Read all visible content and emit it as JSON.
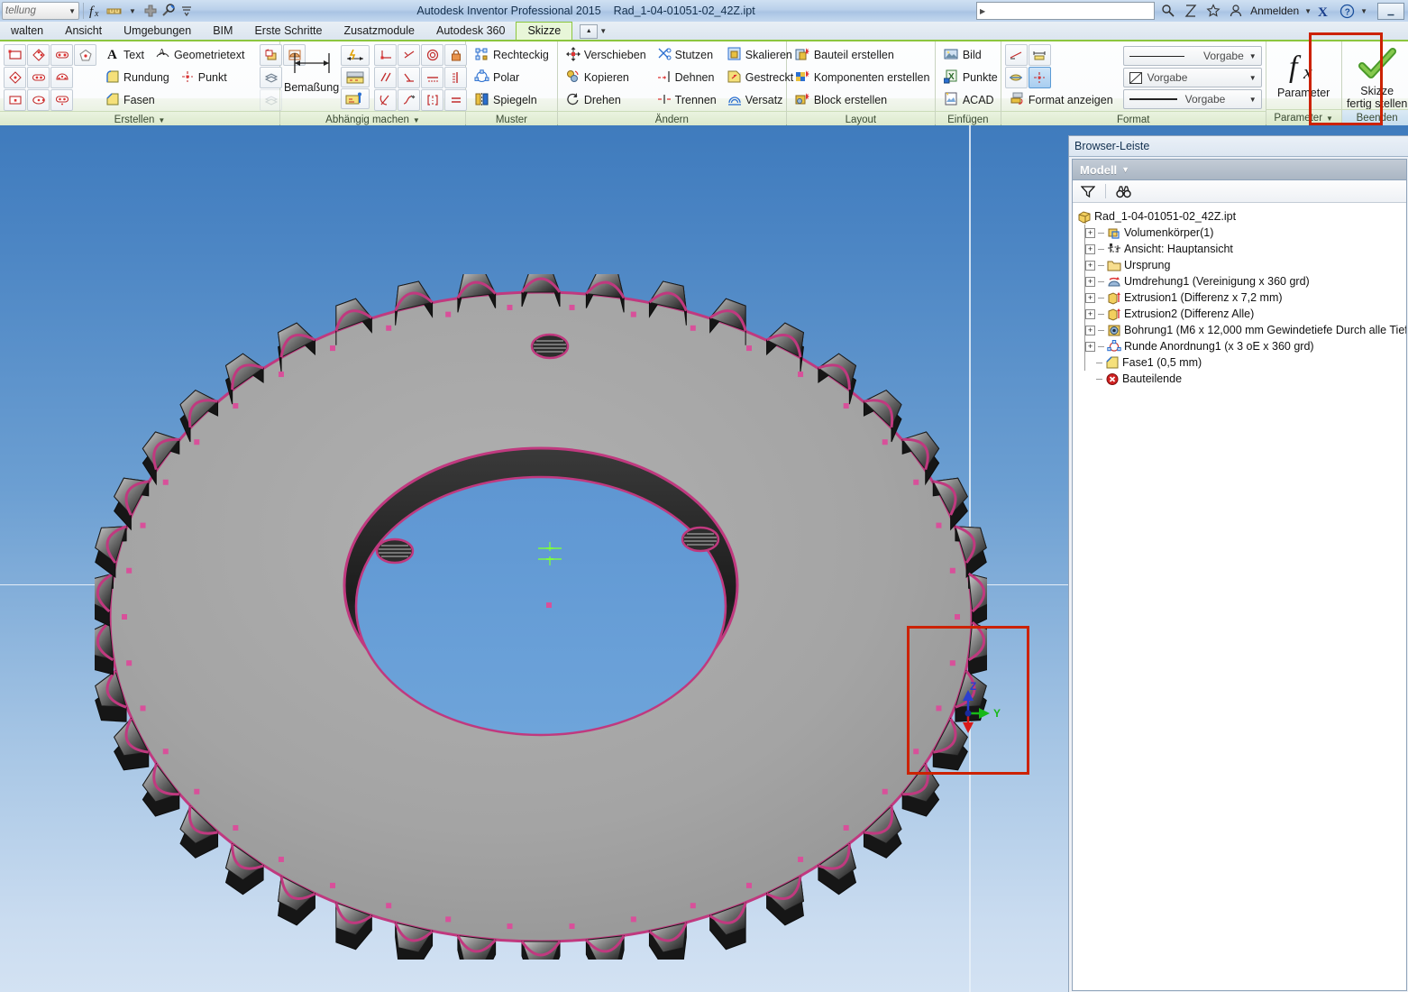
{
  "titlebar": {
    "qat_combo_value": "tellung",
    "qat_icons": [
      "fx-icon",
      "dimension-icon",
      "plus-icon",
      "tools-icon",
      "chevron-down-icon"
    ],
    "app_title": "Autodesk Inventor Professional 2015",
    "document_title": "Rad_1-04-01051-02_42Z.ipt",
    "search_placeholder": "",
    "search_value": "",
    "help_icons": [
      "search-icon",
      "exchange-icon",
      "favorites-star-icon",
      "user-icon"
    ],
    "signin_label": "Anmelden",
    "autodesk_icon": "autodesk-x-icon",
    "help_icon": "help-question-icon",
    "window_buttons": [
      "minimize-button",
      "maximize-button",
      "close-button"
    ]
  },
  "tabs": [
    {
      "label": "walten",
      "active": false
    },
    {
      "label": "Ansicht",
      "active": false
    },
    {
      "label": "Umgebungen",
      "active": false
    },
    {
      "label": "BIM",
      "active": false
    },
    {
      "label": "Erste Schritte",
      "active": false
    },
    {
      "label": "Zusatzmodule",
      "active": false
    },
    {
      "label": "Autodesk 360",
      "active": false
    },
    {
      "label": "Skizze",
      "active": true
    }
  ],
  "ribbon": {
    "groups": [
      {
        "name": "Erstellen",
        "label": "Erstellen",
        "has_dropdown": true,
        "icon_rows": [
          [
            "rectangle-icon",
            "polygon-tool-icon",
            "slot-icon",
            "pentagon-icon"
          ],
          [
            "rhombus-icon",
            "slot-center-icon",
            "slot-three-point-icon"
          ],
          [
            "rectangle-point-icon",
            "ellipse-icon",
            "slot-arc-icon"
          ]
        ],
        "text_buttons": [
          {
            "label": "Text",
            "icon": "text-a-icon"
          },
          {
            "label": "Geometrietext",
            "icon": "geometry-text-icon"
          },
          {
            "label": "Rundung",
            "icon": "fillet-icon"
          },
          {
            "label": "Punkt",
            "icon": "point-icon"
          },
          {
            "label": "Fasen",
            "icon": "chamfer-icon"
          }
        ],
        "side_icons": [
          "project-geometry-icon",
          "project-cut-edges-icon",
          "project-flat-pattern-icon",
          "project-dwg-icon"
        ]
      },
      {
        "name": "Abhaengig-machen",
        "label": "Abhängig machen",
        "has_dropdown": true,
        "big_button": {
          "label": "Bemaßung",
          "icon": "dimension-icon"
        },
        "stack_icons": [
          "auto-dimension-icon",
          "show-constraints-icon",
          "constraint-settings-icon"
        ],
        "constraint_icons": [
          [
            "coincident-icon",
            "collinear-icon",
            "concentric-icon",
            "fix-lock-icon"
          ],
          [
            "parallel-icon",
            "perpendicular-icon",
            "horizontal-icon",
            "vertical-icon"
          ],
          [
            "tangent-icon",
            "smooth-icon",
            "symmetric-icon",
            "equal-icon"
          ]
        ]
      },
      {
        "name": "Muster",
        "label": "Muster",
        "has_dropdown": false,
        "items": [
          {
            "label": "Rechteckig",
            "icon": "rectangular-pattern-icon"
          },
          {
            "label": "Polar",
            "icon": "circular-pattern-icon"
          },
          {
            "label": "Spiegeln",
            "icon": "mirror-icon"
          }
        ]
      },
      {
        "name": "Aendern",
        "label": "Ändern",
        "has_dropdown": false,
        "columns": [
          [
            {
              "label": "Verschieben",
              "icon": "move-icon"
            },
            {
              "label": "Kopieren",
              "icon": "copy-icon"
            },
            {
              "label": "Drehen",
              "icon": "rotate-icon"
            }
          ],
          [
            {
              "label": "Stutzen",
              "icon": "trim-scissors-icon"
            },
            {
              "label": "Dehnen",
              "icon": "extend-icon"
            },
            {
              "label": "Trennen",
              "icon": "split-icon"
            }
          ],
          [
            {
              "label": "Skalieren",
              "icon": "scale-icon"
            },
            {
              "label": "Gestreckt",
              "icon": "stretch-icon"
            },
            {
              "label": "Versatz",
              "icon": "offset-icon"
            }
          ]
        ]
      },
      {
        "name": "Layout",
        "label": "Layout",
        "has_dropdown": false,
        "items": [
          {
            "label": "Bauteil erstellen",
            "icon": "create-part-icon"
          },
          {
            "label": "Komponenten erstellen",
            "icon": "create-component-icon"
          },
          {
            "label": "Block erstellen",
            "icon": "create-block-icon"
          }
        ]
      },
      {
        "name": "Einfuegen",
        "label": "Einfügen",
        "has_dropdown": false,
        "items": [
          {
            "label": "Bild",
            "icon": "image-icon"
          },
          {
            "label": "Punkte",
            "icon": "points-excel-icon"
          },
          {
            "label": "ACAD",
            "icon": "acad-import-icon"
          }
        ]
      },
      {
        "name": "Format",
        "label": "Format",
        "has_dropdown": false,
        "toggle_icons": [
          {
            "icon": "construction-line-icon",
            "selected": false
          },
          {
            "icon": "driven-dimension-icon",
            "selected": false
          },
          {
            "icon": "centerline-icon",
            "selected": false
          },
          {
            "icon": "center-point-icon",
            "selected": true
          }
        ],
        "show_format_label": "Format anzeigen",
        "show_format_icon": "show-format-icon",
        "combos": [
          {
            "name": "line-style-combo",
            "value": "Vorgabe",
            "preview": "line"
          },
          {
            "name": "hatch-style-combo",
            "value": "Vorgabe",
            "preview": "hatch"
          },
          {
            "name": "line-weight-combo",
            "value": "Vorgabe",
            "preview": "line"
          }
        ]
      },
      {
        "name": "Parameter",
        "label": "Parameter",
        "has_dropdown": true,
        "big_button": {
          "label": "Parameter",
          "icon": "fx-parameter-icon"
        }
      },
      {
        "name": "Beenden",
        "label": "Beenden",
        "has_dropdown": false,
        "highlighted": true,
        "big_button": {
          "label_line1": "Skizze",
          "label_line2": "fertig stellen",
          "icon": "green-checkmark-icon"
        }
      }
    ]
  },
  "browser": {
    "title": "Browser-Leiste",
    "model_label": "Modell",
    "toolbar_icons": [
      "filter-funnel-icon",
      "find-binoculars-icon"
    ],
    "tree": [
      {
        "label": "Rad_1-04-01051-02_42Z.ipt",
        "icon": "part-document-icon",
        "depth": 0,
        "expandable": false
      },
      {
        "label": "Volumenkörper(1)",
        "icon": "solid-bodies-icon",
        "depth": 1,
        "expandable": true
      },
      {
        "label": "Ansicht: Hauptansicht",
        "icon": "view-icon",
        "depth": 1,
        "expandable": true
      },
      {
        "label": "Ursprung",
        "icon": "folder-origin-icon",
        "depth": 1,
        "expandable": true
      },
      {
        "label": "Umdrehung1 (Vereinigung x 360 grd)",
        "icon": "revolve-icon",
        "depth": 1,
        "expandable": true
      },
      {
        "label": "Extrusion1 (Differenz x 7,2 mm)",
        "icon": "extrude-icon",
        "depth": 1,
        "expandable": true
      },
      {
        "label": "Extrusion2 (Differenz Alle)",
        "icon": "extrude-icon",
        "depth": 1,
        "expandable": true
      },
      {
        "label": "Bohrung1 (M6 x 12,000 mm Gewindetiefe Durch alle Tiefe)",
        "icon": "hole-icon",
        "depth": 1,
        "expandable": true
      },
      {
        "label": "Runde Anordnung1 (x 3 oE x 360 grd)",
        "icon": "circular-pattern-feature-icon",
        "depth": 1,
        "expandable": true
      },
      {
        "label": "Fase1 (0,5 mm)",
        "icon": "chamfer-feature-icon",
        "depth": 1,
        "expandable": false
      },
      {
        "label": "Bauteilende",
        "icon": "end-of-part-icon",
        "depth": 1,
        "expandable": false
      }
    ]
  },
  "viewport": {
    "model_name": "sprocket-gear-42-teeth",
    "tooth_count": 42,
    "axis_triad": {
      "z_label": "Z",
      "y_label": "Y",
      "x_label": ""
    },
    "selection_marquee": "red-selection-rectangle",
    "colors": {
      "background_top": "#3f7bbd",
      "background_bottom": "#d3e2f3",
      "body_gray": "#a3a3a3",
      "sketch_edge": "#c0397f",
      "bore_blue": "#5b93cf",
      "marquee_red": "#cc2200",
      "highlight_red": "#cc2200",
      "ribbon_green": "#8cc63e",
      "axis_z": "#2b3fcf",
      "axis_y": "#18b818",
      "axis_x": "#d81a1a"
    }
  }
}
